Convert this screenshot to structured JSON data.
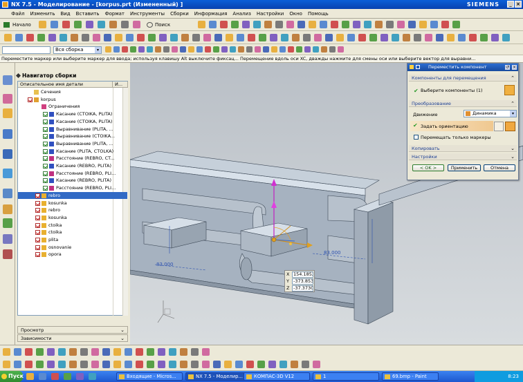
{
  "titlebar": {
    "title": "NX 7.5 - Моделирование - [korpus.prt (Измененный) ]",
    "brand": "SIEMENS"
  },
  "menubar": [
    "Файл",
    "Изменить",
    "Вид",
    "Вставить",
    "Формат",
    "Инструменты",
    "Сборки",
    "Информация",
    "Анализ",
    "Настройки",
    "Окно",
    "Помощь"
  ],
  "toolbar": {
    "start_label": "Начало",
    "command_search": "Поиск команды",
    "assembly_filter": "Вся сборка"
  },
  "cue_line": "Переместите маркер или выберите маркер для ввода; используя клавишу Alt выключите фиксац...   Перемещение вдоль оси XC, дважды нажмите для смены оси или выберите вектор для выравни...",
  "navigator": {
    "title": "Навигатор сборки",
    "col_name": "Описательное имя детали",
    "col_info": "И...",
    "rows": [
      {
        "label": "Сечения",
        "indent": 0,
        "cb": "none",
        "icon": "folder"
      },
      {
        "label": "korpus",
        "indent": 0,
        "cb": "red",
        "icon": "assy"
      },
      {
        "label": "Ограничения",
        "indent": 1,
        "cb": "none",
        "icon": "constr"
      },
      {
        "label": "Касание (CTOIKA, PLITA)",
        "indent": 2,
        "cb": "green",
        "icon": "touch"
      },
      {
        "label": "Касание (CTOIKA, PLITA)",
        "indent": 2,
        "cb": "green",
        "icon": "touch"
      },
      {
        "label": "Выравнивание (PLITA, ...",
        "indent": 2,
        "cb": "green",
        "icon": "align"
      },
      {
        "label": "Выравнивание (CTOIKA...",
        "indent": 2,
        "cb": "green",
        "icon": "align"
      },
      {
        "label": "Выравнивание (PLITA, ...",
        "indent": 2,
        "cb": "green",
        "icon": "align"
      },
      {
        "label": "Касание (PLITA, CTOLKA)",
        "indent": 2,
        "cb": "green",
        "icon": "touch"
      },
      {
        "label": "Расстояние (REBRO, CT...",
        "indent": 2,
        "cb": "green",
        "icon": "dist"
      },
      {
        "label": "Касание (REBRO, PLITA)",
        "indent": 2,
        "cb": "green",
        "icon": "touch"
      },
      {
        "label": "Расстояние (REBRO, PLI...",
        "indent": 2,
        "cb": "green",
        "icon": "dist"
      },
      {
        "label": "Касание (REBRO, PLITA)",
        "indent": 2,
        "cb": "green",
        "icon": "touch"
      },
      {
        "label": "Расстояние (REBRO, PLI...",
        "indent": 2,
        "cb": "green",
        "icon": "dist"
      },
      {
        "label": "rebro",
        "indent": 1,
        "cb": "red",
        "icon": "part",
        "selected": true
      },
      {
        "label": "kosunka",
        "indent": 1,
        "cb": "red",
        "icon": "part"
      },
      {
        "label": "rebro",
        "indent": 1,
        "cb": "red",
        "icon": "part"
      },
      {
        "label": "kosunka",
        "indent": 1,
        "cb": "red",
        "icon": "part"
      },
      {
        "label": "ctoika",
        "indent": 1,
        "cb": "red",
        "icon": "part"
      },
      {
        "label": "ctoika",
        "indent": 1,
        "cb": "red",
        "icon": "part"
      },
      {
        "label": "plita",
        "indent": 1,
        "cb": "red",
        "icon": "part"
      },
      {
        "label": "osnovanie",
        "indent": 1,
        "cb": "red",
        "icon": "part"
      },
      {
        "label": "opora",
        "indent": 1,
        "cb": "red",
        "icon": "part"
      }
    ],
    "preview_label": "Просмотр",
    "deps_label": "Зависимости"
  },
  "dialog": {
    "title": "Переместить компонент",
    "sec_components": "Компоненты для перемещения",
    "select_components": "Выберите компоненты (1)",
    "sec_transform": "Преобразование",
    "motion_label": "Движение",
    "motion_value": "Динамика",
    "set_orientation": "Задать ориентацию",
    "move_markers_only": "Перемещать только маркеры",
    "sec_copy": "Копировать",
    "sec_settings": "Настройки",
    "ok": "< OK >",
    "apply": "Применить",
    "cancel": "Отмена"
  },
  "viewport": {
    "dim_left": "83.000",
    "dim_right": "83.000"
  },
  "coords": {
    "x": "154.1852",
    "y": "-373.8537",
    "z": "-37.37306"
  },
  "taskbar": {
    "start": "Пуск",
    "items": [
      "Входящие - Micros...",
      "NX 7.5 - Моделир...",
      "КОМПАС-3D V12",
      "1",
      "69.bmp - Paint"
    ],
    "clock": "8:23"
  }
}
